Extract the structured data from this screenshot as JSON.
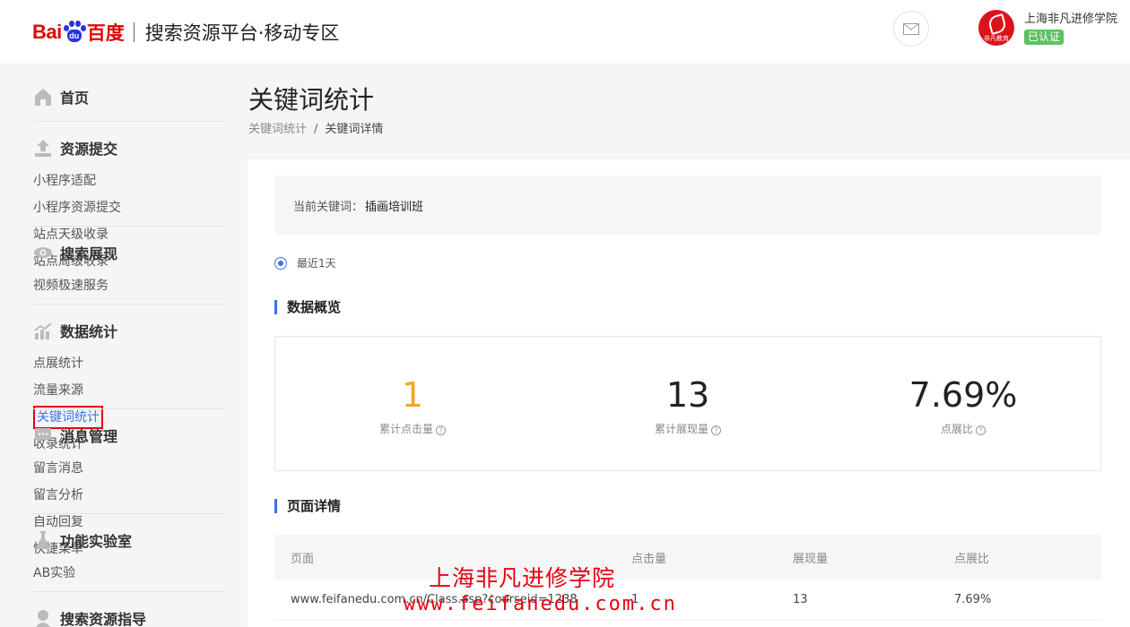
{
  "header": {
    "logo_text": "Bai",
    "logo_paw_text": "du",
    "logo_cn": "百度",
    "platform_title": "搜索资源平台·移动专区",
    "user_name": "上海非凡进修学院",
    "avatar_text": "非凡教育",
    "verified_badge": "已认证",
    "mail_icon": "mail-icon"
  },
  "sidebar": {
    "home": "首页",
    "groups": [
      {
        "title": "资源提交",
        "icon": "upload-icon",
        "items": [
          "小程序适配",
          "小程序资源提交",
          "站点天级收录",
          "站点周级收录"
        ]
      },
      {
        "title": "搜索展现",
        "icon": "eye-icon",
        "items": [
          "视频极速服务"
        ]
      },
      {
        "title": "数据统计",
        "icon": "chart-icon",
        "items": [
          "点展统计",
          "流量来源",
          "关键词统计",
          "收录统计"
        ]
      },
      {
        "title": "消息管理",
        "icon": "message-icon",
        "items": [
          "留言消息",
          "留言分析",
          "自动回复",
          "快捷菜单"
        ]
      },
      {
        "title": "功能实验室",
        "icon": "flask-icon",
        "items": [
          "AB实验"
        ]
      },
      {
        "title": "搜索资源指导",
        "icon": "guide-icon",
        "items": []
      }
    ]
  },
  "main": {
    "title": "关键词统计",
    "breadcrumb": [
      "关键词统计",
      "/",
      "关键词详情"
    ],
    "keyword_label": "当前关键词：",
    "keyword_value": "插画培训班",
    "range_option": "最近1天",
    "overview_title": "数据概览",
    "stats": [
      {
        "value": "1",
        "label": "累计点击量"
      },
      {
        "value": "13",
        "label": "累计展现量"
      },
      {
        "value": "7.69%",
        "label": "点展比"
      }
    ],
    "detail_title": "页面详情",
    "table": {
      "headers": [
        "页面",
        "点击量",
        "展现量",
        "点展比"
      ],
      "rows": [
        [
          "www.feifanedu.com.cn/Class.asp?courseid=1238",
          "1",
          "13",
          "7.69%"
        ]
      ]
    }
  },
  "watermark": {
    "line1": "上海非凡进修学院",
    "line2": "www.feifanedu.com.cn"
  },
  "colors": {
    "accent": "#3a72e8",
    "brand_red": "#e10602",
    "highlight_orange": "#f5a623",
    "verified_green": "#5cc25e"
  }
}
